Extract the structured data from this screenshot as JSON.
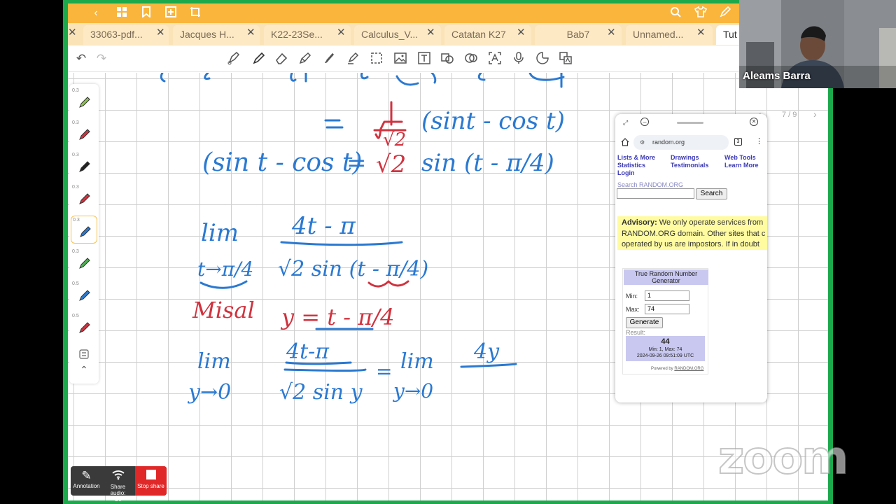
{
  "tabs": [
    {
      "label": "33063-pdf..."
    },
    {
      "label": "Jacques H..."
    },
    {
      "label": "K22-23Se..."
    },
    {
      "label": "Calculus_V..."
    },
    {
      "label": "Catatan K27"
    },
    {
      "label": "Bab7"
    },
    {
      "label": "Unnamed..."
    },
    {
      "label": "Tut"
    }
  ],
  "pen_sizes": [
    "0.3",
    "0.3",
    "0.3",
    "0.3",
    "0.3",
    "0.3",
    "0.5",
    "0.5"
  ],
  "pen_colors": [
    "#8bc34a",
    "#d0333f",
    "#222222",
    "#d0333f",
    "#2a79d1",
    "#4caf50",
    "#2a79d1",
    "#d0333f"
  ],
  "page_counter": "7 / 9",
  "zoom_controls": {
    "annotation": "Annotation",
    "share_audio_1": "Share audio:",
    "share_audio_2": "Off",
    "stop_share": "Stop share"
  },
  "participant": {
    "name": "Aleams Barra"
  },
  "watermark": "zoom",
  "browser": {
    "url": "random.org",
    "nav": {
      "lists_more": "Lists & More",
      "drawings": "Drawings",
      "web_tools": "Web Tools",
      "statistics": "Statistics",
      "testimonials": "Testimonials",
      "learn_more": "Learn More",
      "login": "Login"
    },
    "search_label": "Search RANDOM.ORG",
    "search_button": "Search",
    "advisory_bold": "Advisory:",
    "advisory_line1": " We only operate services from",
    "advisory_line2": "RANDOM.ORG domain. Other sites that c",
    "advisory_line3": "operated by us are impostors. If in doubt",
    "rng": {
      "title_1": "True Random Number",
      "title_2": "Generator",
      "min_label": "Min:",
      "min_value": "1",
      "max_label": "Max:",
      "max_value": "74",
      "generate": "Generate",
      "result_label": "Result:",
      "result_value": "44",
      "result_range": "Min: 1, Max: 74",
      "result_time": "2024-09-26 09:51:09 UTC",
      "powered_by": "Powered by",
      "powered_link": "RANDOM.ORG"
    }
  },
  "ink": {
    "eq1_frac_num": "1",
    "eq1_frac_den": "√2",
    "eq1_paren": "(sint - cos t)",
    "eq2_left": "(sin t - cos t)",
    "eq2_eq": "=",
    "eq2_sqrt": "√2",
    "eq2_right": "sin (t - π/4)",
    "lim_word": "lim",
    "lim_sub": "t→π/4",
    "frac_num": "4t - π",
    "frac_den": "√2 sin (t - π/4)",
    "misal": "Misal",
    "y_sub": "y = t - π/4",
    "lim2_word": "lim",
    "lim2_sub": "y→0",
    "frac2_num": "4t-π",
    "frac2_den": "√2  sin y",
    "eq3": "=",
    "lim3_word": "lim",
    "lim3_sub": "y→0",
    "frac3_num": "4y"
  }
}
